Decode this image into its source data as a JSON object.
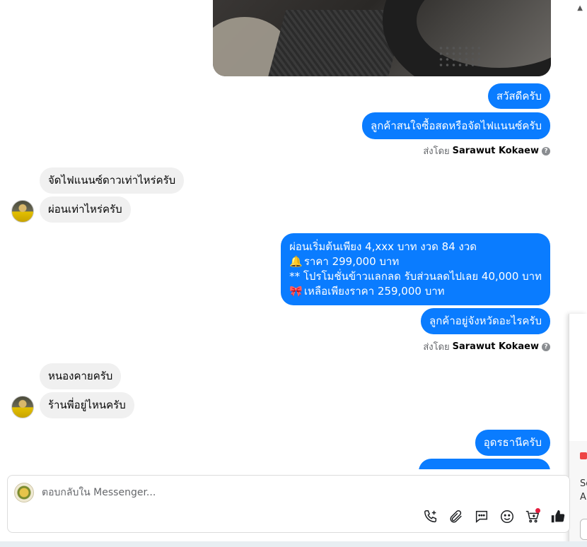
{
  "messages": [
    {
      "id": "m1",
      "dir": "out",
      "text": "สวัสดีครับ"
    },
    {
      "id": "m2",
      "dir": "out",
      "text": "ลูกค้าสนใจซื้อสดหรือจัดไฟแนนซ์ครับ"
    },
    {
      "id": "m3",
      "dir": "in",
      "text": "จัดไฟแนนซ์ดาวเท่าไหร่ครับ"
    },
    {
      "id": "m4",
      "dir": "in",
      "text": "ผ่อนเท่าไหร่ครับ"
    },
    {
      "id": "m5",
      "dir": "out",
      "lines": [
        "ผ่อนเริ่มต้นเพียง 4,xxx บาท งวด 84 งวด",
        "ราคา 299,000 บาท",
        "** โปรโมชั่นข้าวแลกลด รับส่วนลดไปเลย 40,000 บาท",
        " เหลือเพียงราคา 259,000 บาท"
      ]
    },
    {
      "id": "m6",
      "dir": "out",
      "text": "ลูกค้าอยู่จังหวัดอะไรครับ"
    },
    {
      "id": "m7",
      "dir": "in",
      "text": "หนองคายครับ"
    },
    {
      "id": "m8",
      "dir": "in",
      "text": "ร้านพี่อยู่ไหนครับ"
    },
    {
      "id": "m9",
      "dir": "out",
      "text": "อุดรธานีครับ"
    }
  ],
  "sent_by": {
    "prefix": "ส่งโดย",
    "name": "Sarawut Kokaew",
    "help": "?"
  },
  "right_panel": {
    "line1": "Se",
    "line2": "A"
  },
  "composer": {
    "placeholder": "ตอบกลับใน Messenger...",
    "tools": [
      "call-add-icon",
      "attachment-icon",
      "saved-reply-icon",
      "emoji-icon",
      "cart-icon",
      "like-icon"
    ]
  },
  "colors": {
    "outgoing": "#0a7cff",
    "incoming": "#f0f0f0",
    "notification_dot": "#e41e3f"
  }
}
